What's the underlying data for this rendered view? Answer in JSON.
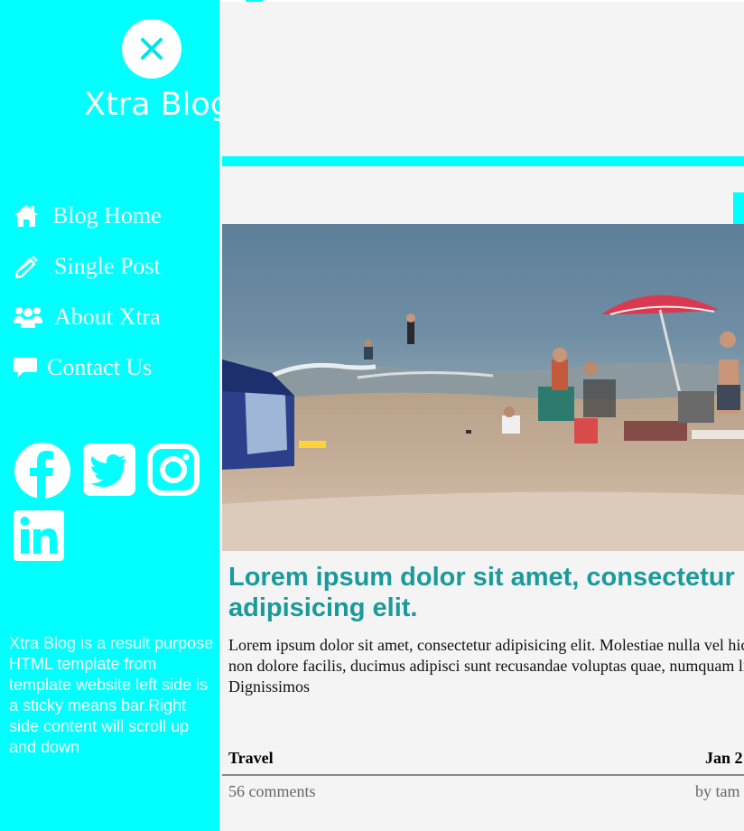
{
  "sidebar": {
    "brand": "Xtra Blog",
    "nav": [
      {
        "label": "Blog Home",
        "icon": "home-icon"
      },
      {
        "label": "Single Post",
        "icon": "pencil-icon"
      },
      {
        "label": "About Xtra",
        "icon": "users-icon"
      },
      {
        "label": "Contact Us",
        "icon": "comment-icon"
      }
    ],
    "social": [
      "facebook-icon",
      "twitter-icon",
      "instagram-icon",
      "linkedin-icon"
    ],
    "description": "Xtra Blog is a result purpose HTML template from template website left side is a sticky means bar.Right side content will scroll up and down"
  },
  "post": {
    "title": "Lorem ipsum dolor sit amet, consectetur adipisicing elit.",
    "excerpt": "Lorem ipsum dolor sit amet, consectetur adipisicing elit. Molestiae nulla vel hic aspernatur, sequi non dolore facilis, ducimus adipisci sunt recusandae voluptas quae, numquam libero obcaecati et? Dignissimos",
    "category": "Travel",
    "date": "Jan 2",
    "comments": "56 comments",
    "author": "by tam"
  },
  "colors": {
    "accent": "#00ffff",
    "title": "#1a9a9a",
    "background": "#f4f4f4"
  }
}
